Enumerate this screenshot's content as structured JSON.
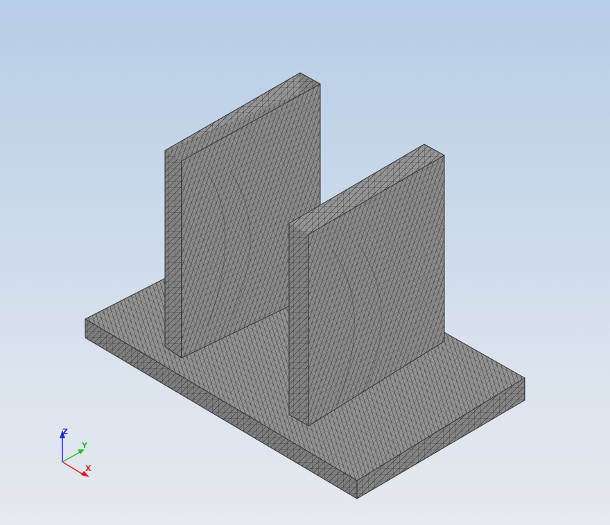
{
  "viewport": {
    "background_top": "#b6cde6",
    "background_bottom": "#e6e9ee"
  },
  "model": {
    "type": "tetrahedral-mesh",
    "parts": [
      "base-plate",
      "rear-wall",
      "front-wall"
    ],
    "face_color": "#8c8c8c",
    "top_face_color": "#959595",
    "side_face_color": "#7a7a7a",
    "edge_color": "#2e2e2e"
  },
  "triad": {
    "z_label": "Z",
    "y_label": "Y",
    "x_label": "X",
    "z_color": "#1f2fd8",
    "y_color": "#22c02a",
    "x_color": "#e01818"
  }
}
